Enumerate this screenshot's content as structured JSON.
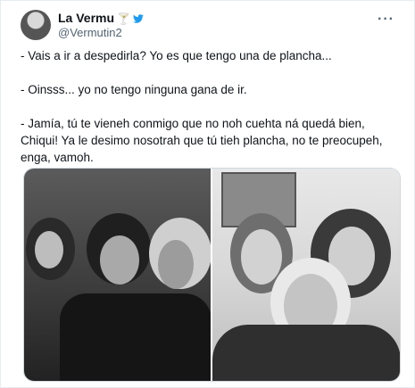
{
  "author": {
    "display_name": "La Vermu",
    "name_emoji": "🍸",
    "handle": "@Vermutin2",
    "verified_icon": "bird-icon",
    "more_icon": "more-dots-icon"
  },
  "tweet": {
    "text": "- Vais a ir a despedirla? Yo es que tengo una de plancha...\n\n- Oinsss... yo no tengo ninguna gana de ir.\n\n- Jamía, tú te vieneh conmigo que no noh cuehta ná quedá bien, Chiqui! Ya le desimo nosotrah que tú tieh plancha, no te preocupeh, enga, vamoh."
  },
  "media": {
    "count": 2,
    "style": "black-and-white photos"
  },
  "colors": {
    "text": "#0f1419",
    "secondary": "#536471",
    "border": "#cfd9de"
  }
}
